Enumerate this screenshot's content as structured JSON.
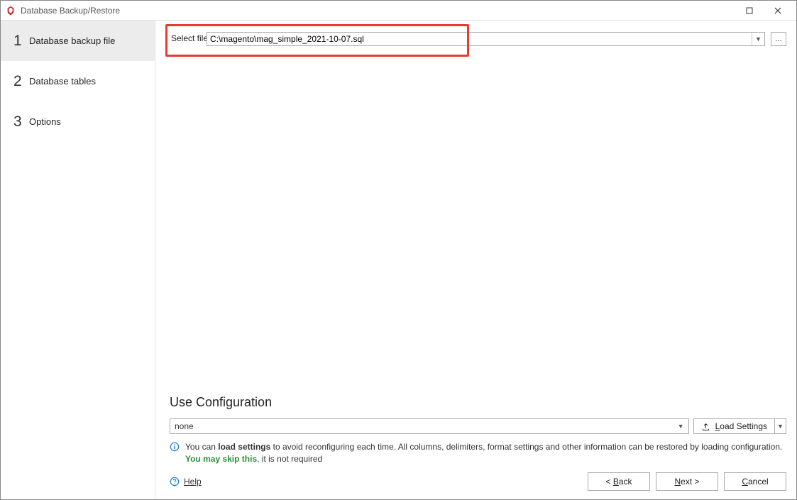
{
  "window": {
    "title": "Database Backup/Restore"
  },
  "sidebar": {
    "items": [
      {
        "num": "1",
        "label": "Database backup file",
        "active": true
      },
      {
        "num": "2",
        "label": "Database tables",
        "active": false
      },
      {
        "num": "3",
        "label": "Options",
        "active": false
      }
    ]
  },
  "file_select": {
    "label": "Select file",
    "value": "C:\\magento\\mag_simple_2021-10-07.sql",
    "browse_label": "..."
  },
  "config": {
    "heading": "Use Configuration",
    "selected": "none",
    "load_button": "Load Settings"
  },
  "info": {
    "pre": "You can ",
    "bold": "load settings",
    "mid": " to avoid reconfiguring each time. All columns, delimiters, format settings and other information can be restored by loading configuration. ",
    "green": "You may skip this",
    "post": ", it is not required"
  },
  "help": {
    "label": "Help"
  },
  "buttons": {
    "back": "< Back",
    "next": "Next >",
    "cancel": "Cancel"
  }
}
